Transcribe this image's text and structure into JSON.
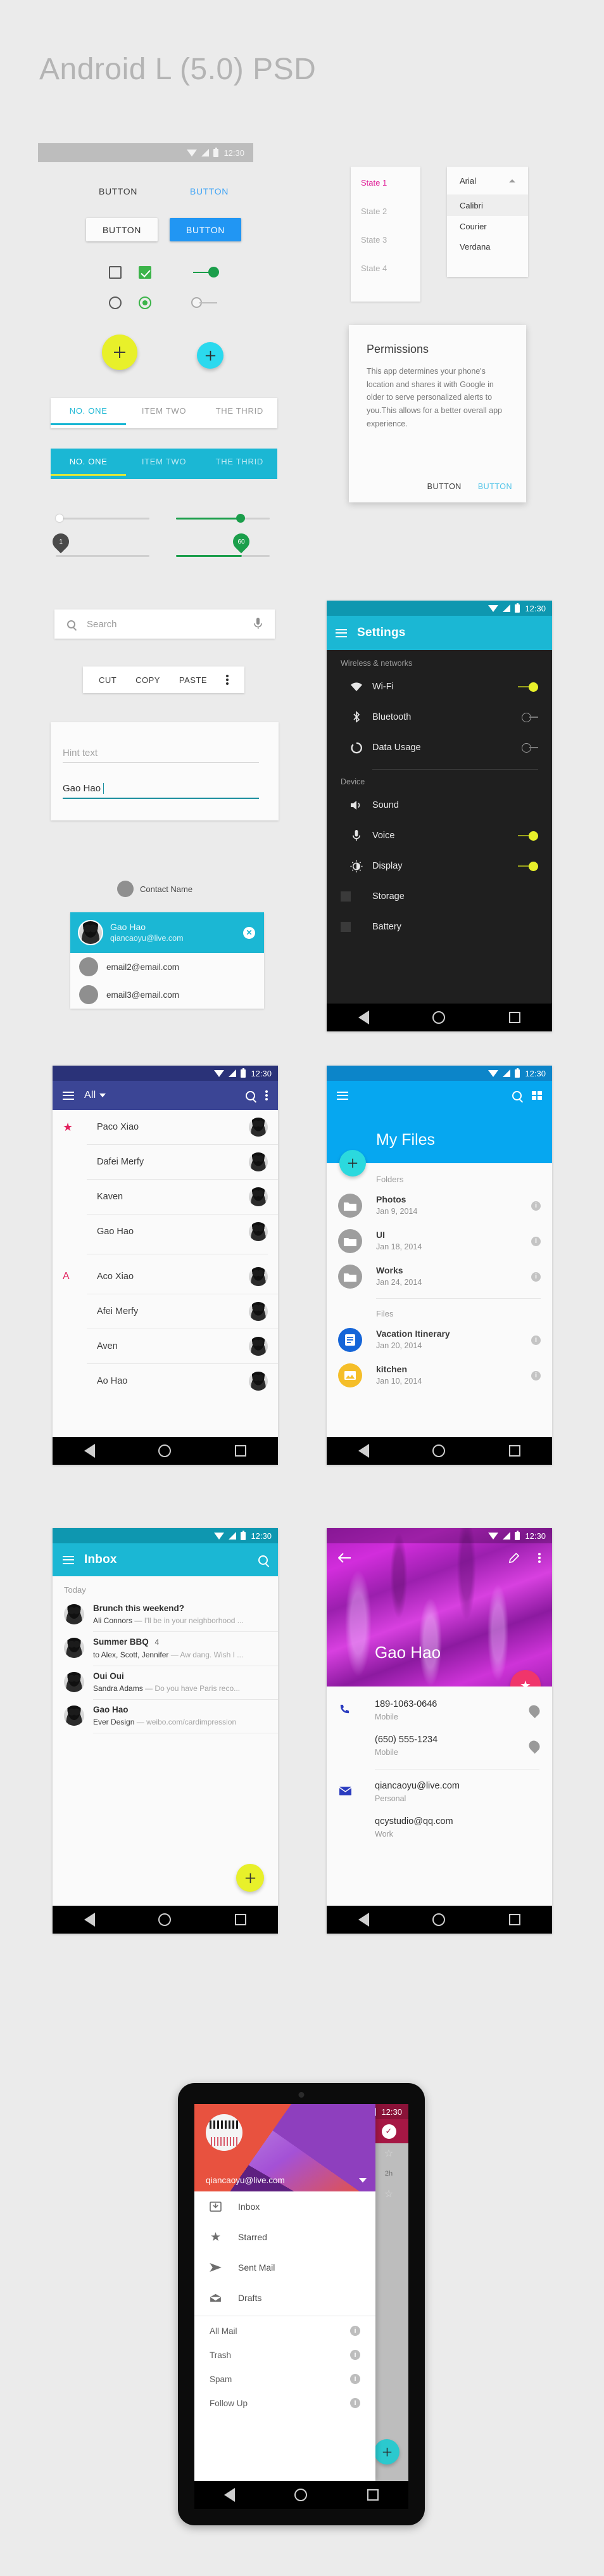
{
  "page": {
    "title": "Android L (5.0) PSD"
  },
  "colors": {
    "cyan": "#1BB7D4",
    "cyan_light": "#25D3E8",
    "blue": "#2196F3",
    "yellow": "#E8F02A",
    "green": "#1B9E4B",
    "pink": "#E8336B",
    "indigo": "#3B4595",
    "magenta": "#C2299C",
    "purple": "#C02BC7",
    "crimson": "#A61744",
    "teal": "#21C4CB",
    "amber": "#F5BE29"
  },
  "statusbar": {
    "time": "12:30"
  },
  "widgets": {
    "flat_button_default": "BUTTON",
    "flat_button_accent": "BUTTON",
    "raised_button_default": "BUTTON",
    "raised_button_accent": "BUTTON",
    "tabs_light": [
      "NO. ONE",
      "ITEM TWO",
      "THE THRID"
    ],
    "tabs_dark": [
      "NO. ONE",
      "ITEM TWO",
      "THE THRID"
    ],
    "slider_left_value": "1",
    "slider_right_value": "60",
    "search_placeholder": "Search",
    "text_toolbar": [
      "CUT",
      "COPY",
      "PASTE"
    ],
    "hint_text": "Hint text",
    "filled_text": "Gao Hao",
    "contact_name_label": "Contact Name"
  },
  "state_list": {
    "items": [
      {
        "label": "State 1",
        "active": true
      },
      {
        "label": "State 2",
        "active": false
      },
      {
        "label": "State 3",
        "active": false
      },
      {
        "label": "State 4",
        "active": false
      }
    ]
  },
  "font_dropdown": {
    "selected": "Arial",
    "options": [
      "Calibri",
      "Courier",
      "Verdana"
    ]
  },
  "permissions_dialog": {
    "title": "Permissions",
    "body": "This app determines your phone's location and shares it with Google in older to serve personalized alerts to you.This allows for a better overall app experience.",
    "button_default": "BUTTON",
    "button_accent": "BUTTON"
  },
  "contact_chip": {
    "name": "Gao Hao",
    "email": "qiancaoyu@live.com",
    "suggestions": [
      "email2@email.com",
      "email3@email.com"
    ]
  },
  "settings_screen": {
    "title": "Settings",
    "sections": [
      {
        "header": "Wireless & networks",
        "items": [
          {
            "label": "Wi-Fi",
            "icon": "wifi-icon",
            "toggle": "on"
          },
          {
            "label": "Bluetooth",
            "icon": "bluetooth-icon",
            "toggle": "off"
          },
          {
            "label": "Data Usage",
            "icon": "data-usage-icon",
            "toggle": "off"
          }
        ]
      },
      {
        "header": "Device",
        "items": [
          {
            "label": "Sound",
            "icon": "volume-icon",
            "toggle": "none"
          },
          {
            "label": "Voice",
            "icon": "microphone-icon",
            "toggle": "on"
          },
          {
            "label": "Display",
            "icon": "brightness-icon",
            "toggle": "on"
          },
          {
            "label": "Storage",
            "icon": "storage-icon",
            "toggle": "none"
          },
          {
            "label": "Battery",
            "icon": "battery-icon",
            "toggle": "none"
          }
        ]
      }
    ]
  },
  "contacts_screen": {
    "filter": "All",
    "groups": [
      {
        "marker": "star",
        "items": [
          "Paco Xiao",
          "Dafei Merfy",
          "Kaven",
          "Gao Hao"
        ]
      },
      {
        "marker": "A",
        "items": [
          "Aco Xiao",
          "Afei Merfy",
          "Aven",
          "Ao Hao"
        ]
      }
    ]
  },
  "files_screen": {
    "title": "My Files",
    "sections": [
      {
        "header": "Folders",
        "items": [
          {
            "name": "Photos",
            "date": "Jan 9, 2014",
            "kind": "folder"
          },
          {
            "name": "UI",
            "date": "Jan 18, 2014",
            "kind": "folder"
          },
          {
            "name": "Works",
            "date": "Jan 24, 2014",
            "kind": "folder"
          }
        ]
      },
      {
        "header": "Files",
        "items": [
          {
            "name": "Vacation Itinerary",
            "date": "Jan 20, 2014",
            "kind": "doc"
          },
          {
            "name": "kitchen",
            "date": "Jan 10, 2014",
            "kind": "image"
          }
        ]
      }
    ]
  },
  "inbox_screen": {
    "title": "Inbox",
    "section_header": "Today",
    "messages": [
      {
        "subject": "Brunch this weekend?",
        "count": "",
        "sender": "Ali Connors",
        "preview": "I'll be in your neighborhood ..."
      },
      {
        "subject": "Summer BBQ",
        "count": "4",
        "sender": "to Alex, Scott, Jennifer",
        "preview": "Aw dang. Wish I ..."
      },
      {
        "subject": "Oui Oui",
        "count": "",
        "sender": "Sandra Adams",
        "preview": "Do you have Paris reco..."
      },
      {
        "subject": "Gao Hao",
        "count": "",
        "sender": "Ever Design",
        "preview": "weibo.com/cardimpression"
      }
    ]
  },
  "contact_detail": {
    "name": "Gao Hao",
    "rows": [
      {
        "value": "189-1063-0646",
        "label": "Mobile",
        "icon": "phone-icon",
        "action": "message-icon"
      },
      {
        "value": "(650) 555-1234",
        "label": "Mobile",
        "icon": "",
        "action": "message-icon"
      },
      {
        "value": "qiancaoyu@live.com",
        "label": "Personal",
        "icon": "mail-icon",
        "action": ""
      },
      {
        "value": "qcystudio@qq.com",
        "label": "Work",
        "icon": "",
        "action": ""
      }
    ]
  },
  "mail_drawer": {
    "account_email": "qiancaoyu@live.com",
    "primary_items": [
      {
        "label": "Inbox",
        "icon": "inbox-icon"
      },
      {
        "label": "Starred",
        "icon": "star-icon"
      },
      {
        "label": "Sent Mail",
        "icon": "send-icon"
      },
      {
        "label": "Drafts",
        "icon": "drafts-icon"
      }
    ],
    "secondary_items": [
      {
        "label": "All Mail",
        "icon": "info-icon"
      },
      {
        "label": "Trash",
        "icon": "info-icon"
      },
      {
        "label": "Spam",
        "icon": "info-icon"
      },
      {
        "label": "Follow Up",
        "icon": "info-icon"
      }
    ],
    "behind_list": [
      {
        "time": "15m"
      },
      {
        "time": "2h"
      }
    ]
  }
}
